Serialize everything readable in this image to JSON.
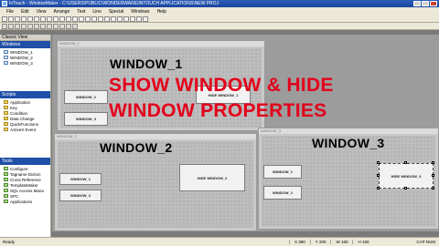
{
  "titlebar": {
    "title": "InTouch - WindowMaker - C:\\USERS\\PUBLIC\\WONDERWARE\\INTOUCH APPLICATIONS\\NEW PROJ"
  },
  "menubar": {
    "items": [
      "File",
      "Edit",
      "View",
      "Arrange",
      "Text",
      "Line",
      "Special",
      "Windows",
      "Help"
    ]
  },
  "sidebar": {
    "header": "Classic View",
    "windows_title": "Windows",
    "windows": [
      "WINDOW_1",
      "WINDOW_2",
      "WINDOW_3"
    ],
    "scripts_title": "Scripts",
    "scripts": [
      "Application",
      "Key",
      "Condition",
      "Data Change",
      "QuickFunctions",
      "ActiveX Event"
    ],
    "tools_title": "Tools",
    "tools": [
      "Configure",
      "Tagname Diction",
      "Cross Reference",
      "TemplateMaker",
      "SQL Access Mana",
      "SPC",
      "Applications"
    ]
  },
  "windows": {
    "w1": {
      "tab": "WINDOW_1",
      "name": "WINDOW_1",
      "btn1": "WINDOW_2",
      "btn2": "WINDOW_3",
      "btn3": "HIDE WINDOW_1"
    },
    "w2": {
      "tab": "WINDOW_2",
      "name": "WINDOW_2",
      "btn1": "WINDOW_1",
      "btn2": "WINDOW_3",
      "btn3": "HIDE WINDOW_2"
    },
    "w3": {
      "tab": "WINDOW_3",
      "name": "WINDOW_3",
      "btn1": "WINDOW_1",
      "btn2": "WINDOW_2",
      "btn3": "HIDE WINDOW_3"
    }
  },
  "overlay": {
    "line1": "SHOW WINDOW & HIDE",
    "line2": "WINDOW PROPERTIES"
  },
  "statusbar": {
    "left": "Ready",
    "x": "X 380",
    "y": "Y 200",
    "w": "W 160",
    "h": "H 160",
    "right": "CAP NUM"
  },
  "colors": {
    "overlay_text": "#e3001b",
    "titlebar": "#1f4fa7"
  }
}
